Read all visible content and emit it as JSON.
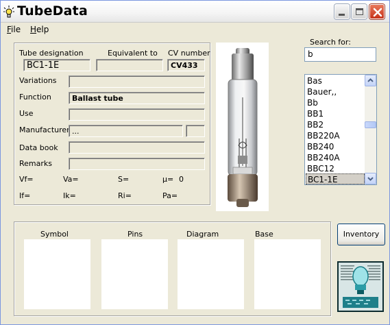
{
  "window": {
    "title": "TubeData"
  },
  "menu": [
    {
      "label": "File",
      "underline": "F",
      "rest": "ile"
    },
    {
      "label": "Help",
      "underline": "H",
      "rest": "elp"
    }
  ],
  "details": {
    "tube_designation_label": "Tube designation",
    "equivalent_to_label": "Equivalent to",
    "cv_number_label": "CV number",
    "tube_designation": "BC1-1E",
    "equivalent_to": "",
    "cv_number": "CV433",
    "variations_label": "Variations",
    "variations": "",
    "function_label": "Function",
    "function": "Ballast tube",
    "use_label": "Use",
    "use": "",
    "manufacturer_label": "Manufacturer",
    "manufacturer": "...",
    "manufacturer_extra": "",
    "data_book_label": "Data book",
    "data_book": "",
    "remarks_label": "Remarks",
    "remarks": ""
  },
  "params": {
    "vf": "Vf=",
    "va": "Va=",
    "s": "S=",
    "mu": "µ=",
    "mu_value": "0",
    "if": "If=",
    "ik": "Ik=",
    "ri": "Ri=",
    "pa": "Pa="
  },
  "search": {
    "label": "Search for:",
    "value": "b"
  },
  "list": {
    "items": [
      "Bas",
      "Bauer,,",
      "Bb",
      "BB1",
      "BB2",
      "BB220A",
      "BB240",
      "BB240A",
      "BBC12",
      "BC1-1E"
    ],
    "selected": "BC1-1E"
  },
  "panels": {
    "symbol": "Symbol",
    "pins": "Pins",
    "diagram": "Diagram",
    "base": "Base"
  },
  "buttons": {
    "inventory": "Inventory"
  },
  "icons": {
    "app": "lightbulb-icon",
    "minimize": "minimize-icon",
    "maximize": "maximize-icon",
    "close": "close-icon",
    "scroll_up": "chevron-up-icon",
    "scroll_down": "chevron-down-icon"
  },
  "colors": {
    "window_bg": "#ece9d8",
    "close_red": "#c6331a",
    "list_border": "#7f9db9"
  }
}
